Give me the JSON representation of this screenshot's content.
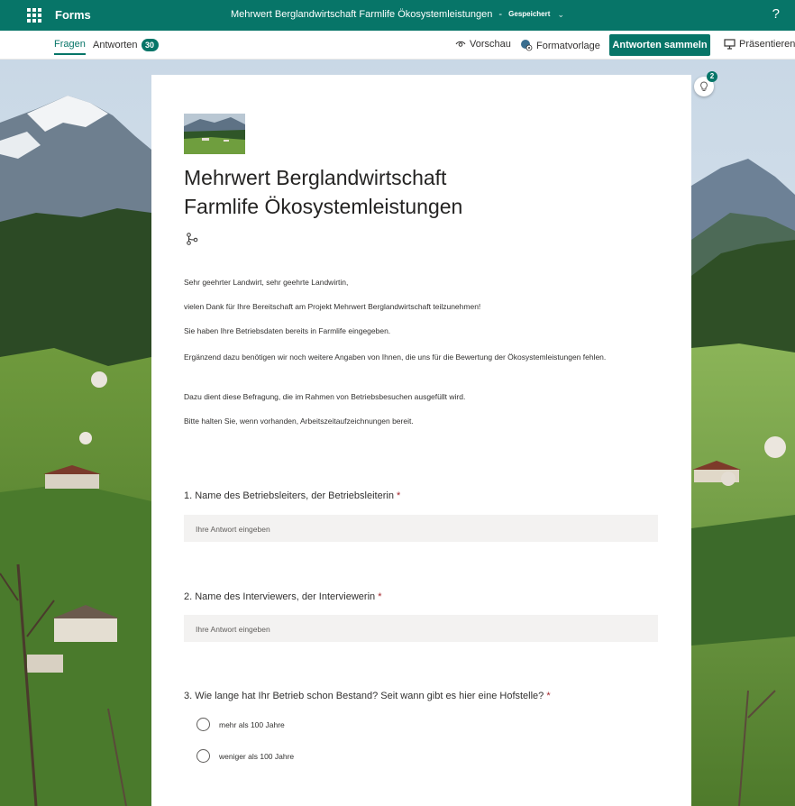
{
  "app": {
    "name": "Forms"
  },
  "document": {
    "title": "Mehrwert Berglandwirtschaft  Farmlife Ökosystemleistungen",
    "separator": "-",
    "status": "Gespeichert"
  },
  "help_label": "?",
  "tabs": [
    {
      "label": "Fragen",
      "active": true
    },
    {
      "label": "Antworten",
      "count": "30"
    }
  ],
  "toolbar": {
    "preview": "Vorschau",
    "theme": "Formatvorlage",
    "collect": "Antworten sammeln",
    "present": "Präsentieren"
  },
  "ideas_count": "2",
  "form": {
    "title_line1": "Mehrwert Berglandwirtschaft",
    "title_line2": "Farmlife Ökosystemleistungen",
    "description": [
      "Sehr geehrter Landwirt, sehr geehrte Landwirtin,",
      "vielen Dank für Ihre Bereitschaft am Projekt Mehrwert Berglandwirtschaft teilzunehmen!",
      "Sie haben Ihre Betriebsdaten bereits in Farmlife eingegeben.",
      "Ergänzend dazu benötigen wir noch weitere Angaben von Ihnen, die uns für die Bewertung der Ökosystemleistungen fehlen.",
      "Dazu dient diese Befragung, die im Rahmen von Betriebsbesuchen ausgefüllt wird.",
      "Bitte halten Sie, wenn vorhanden, Arbeitszeitaufzeichnungen bereit."
    ],
    "questions": [
      {
        "text": "1. Name des Betriebsleiters, der Betriebsleiterin",
        "required_mark": "*",
        "placeholder": "Ihre Antwort eingeben"
      },
      {
        "text": "2. Name des Interviewers, der Interviewerin",
        "required_mark": "*",
        "placeholder": "Ihre Antwort eingeben"
      },
      {
        "text": "3. Wie lange hat Ihr Betrieb schon Bestand? Seit wann gibt es hier eine Hofstelle?",
        "required_mark": "*",
        "options": [
          "mehr als 100 Jahre",
          "weniger als 100 Jahre"
        ]
      }
    ]
  },
  "colors": {
    "accent": "#077568",
    "required": "#a4262c",
    "input_bg": "#f3f2f1"
  }
}
